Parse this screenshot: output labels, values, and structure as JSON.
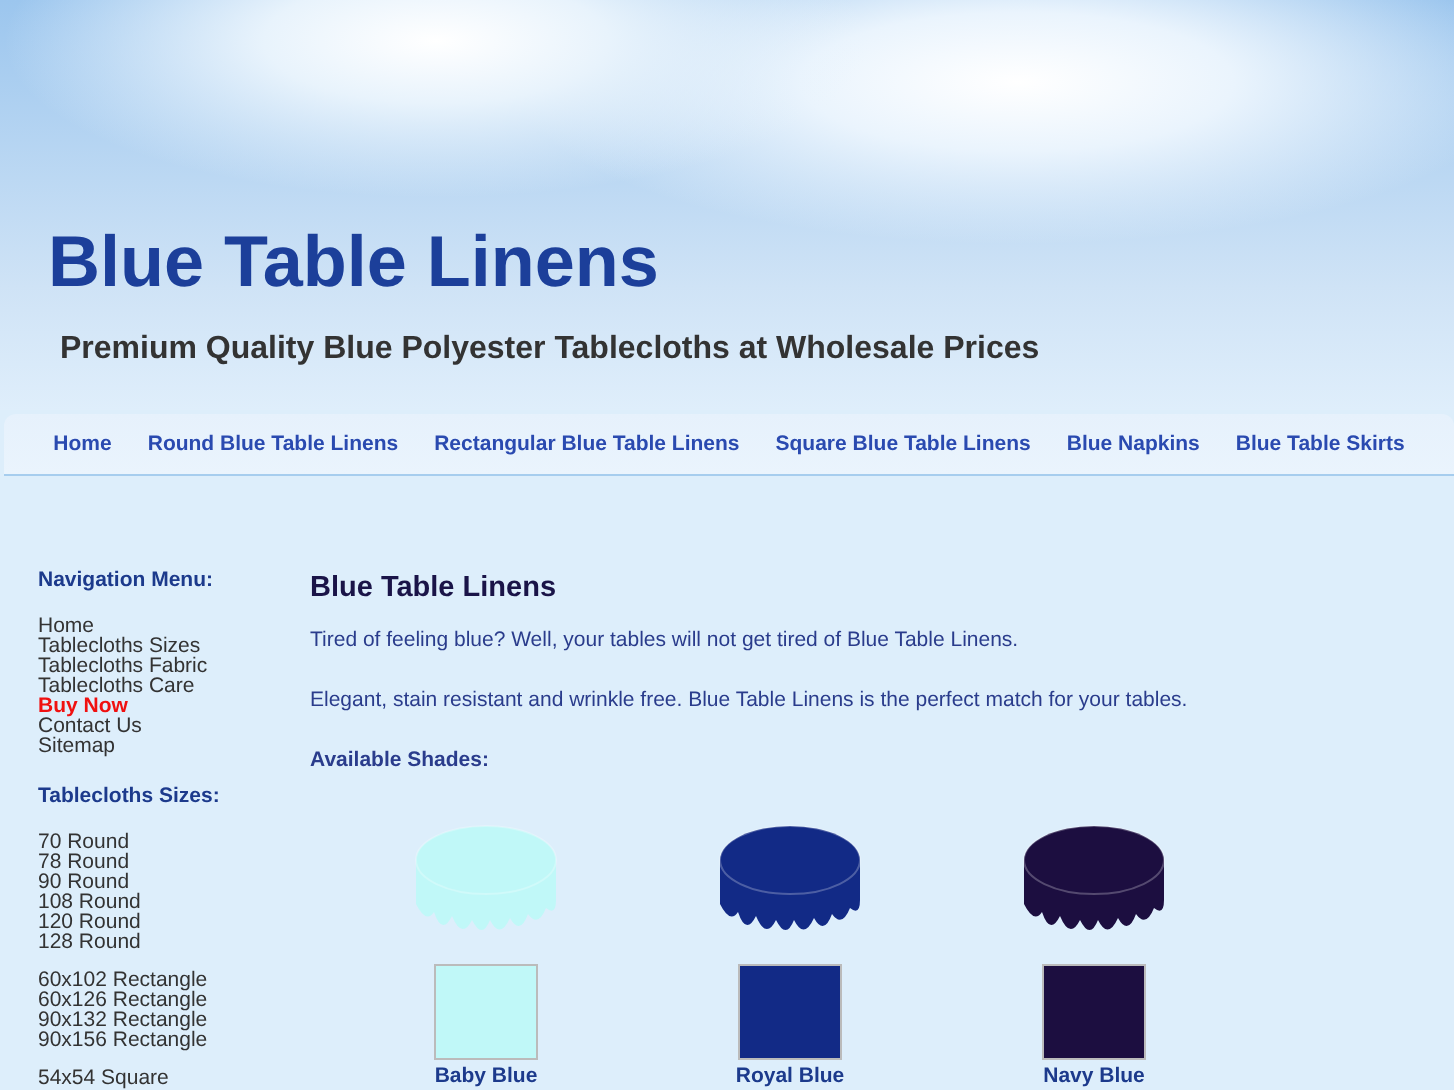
{
  "header": {
    "title": "Blue Table Linens",
    "tagline": "Premium Quality Blue Polyester Tablecloths at Wholesale Prices"
  },
  "nav": [
    "Home",
    "Round Blue Table Linens",
    "Rectangular Blue Table Linens",
    "Square Blue Table Linens",
    "Blue Napkins",
    "Blue Table Skirts"
  ],
  "sidebar": [
    {
      "heading": "Navigation Menu:",
      "groups": [
        [
          {
            "label": "Home",
            "highlight": false
          },
          {
            "label": "Tablecloths Sizes",
            "highlight": false
          },
          {
            "label": "Tablecloths Fabric",
            "highlight": false
          },
          {
            "label": "Tablecloths Care",
            "highlight": false
          },
          {
            "label": "Buy Now",
            "highlight": true
          },
          {
            "label": "Contact Us",
            "highlight": false
          },
          {
            "label": "Sitemap",
            "highlight": false
          }
        ]
      ]
    },
    {
      "heading": "Tablecloths Sizes:",
      "groups": [
        [
          {
            "label": "70 Round",
            "highlight": false
          },
          {
            "label": "78 Round",
            "highlight": false
          },
          {
            "label": "90 Round",
            "highlight": false
          },
          {
            "label": "108 Round",
            "highlight": false
          },
          {
            "label": "120 Round",
            "highlight": false
          },
          {
            "label": "128 Round",
            "highlight": false
          }
        ],
        [
          {
            "label": "60x102 Rectangle",
            "highlight": false
          },
          {
            "label": "60x126 Rectangle",
            "highlight": false
          },
          {
            "label": "90x132 Rectangle",
            "highlight": false
          },
          {
            "label": "90x156 Rectangle",
            "highlight": false
          }
        ],
        [
          {
            "label": "54x54 Square",
            "highlight": false
          }
        ]
      ]
    }
  ],
  "content": {
    "heading": "Blue Table Linens",
    "paragraphs": [
      "Tired of feeling blue? Well, your tables will not get tired of Blue Table Linens.",
      "Elegant, stain resistant and wrinkle free. Blue Table Linens is the perfect match for your tables."
    ],
    "shades_heading": "Available Shades:",
    "shades": [
      {
        "name": "Baby Blue",
        "color": "#c0f8f8"
      },
      {
        "name": "Royal Blue",
        "color": "#122a86"
      },
      {
        "name": "Navy Blue",
        "color": "#1c0e40"
      }
    ]
  }
}
